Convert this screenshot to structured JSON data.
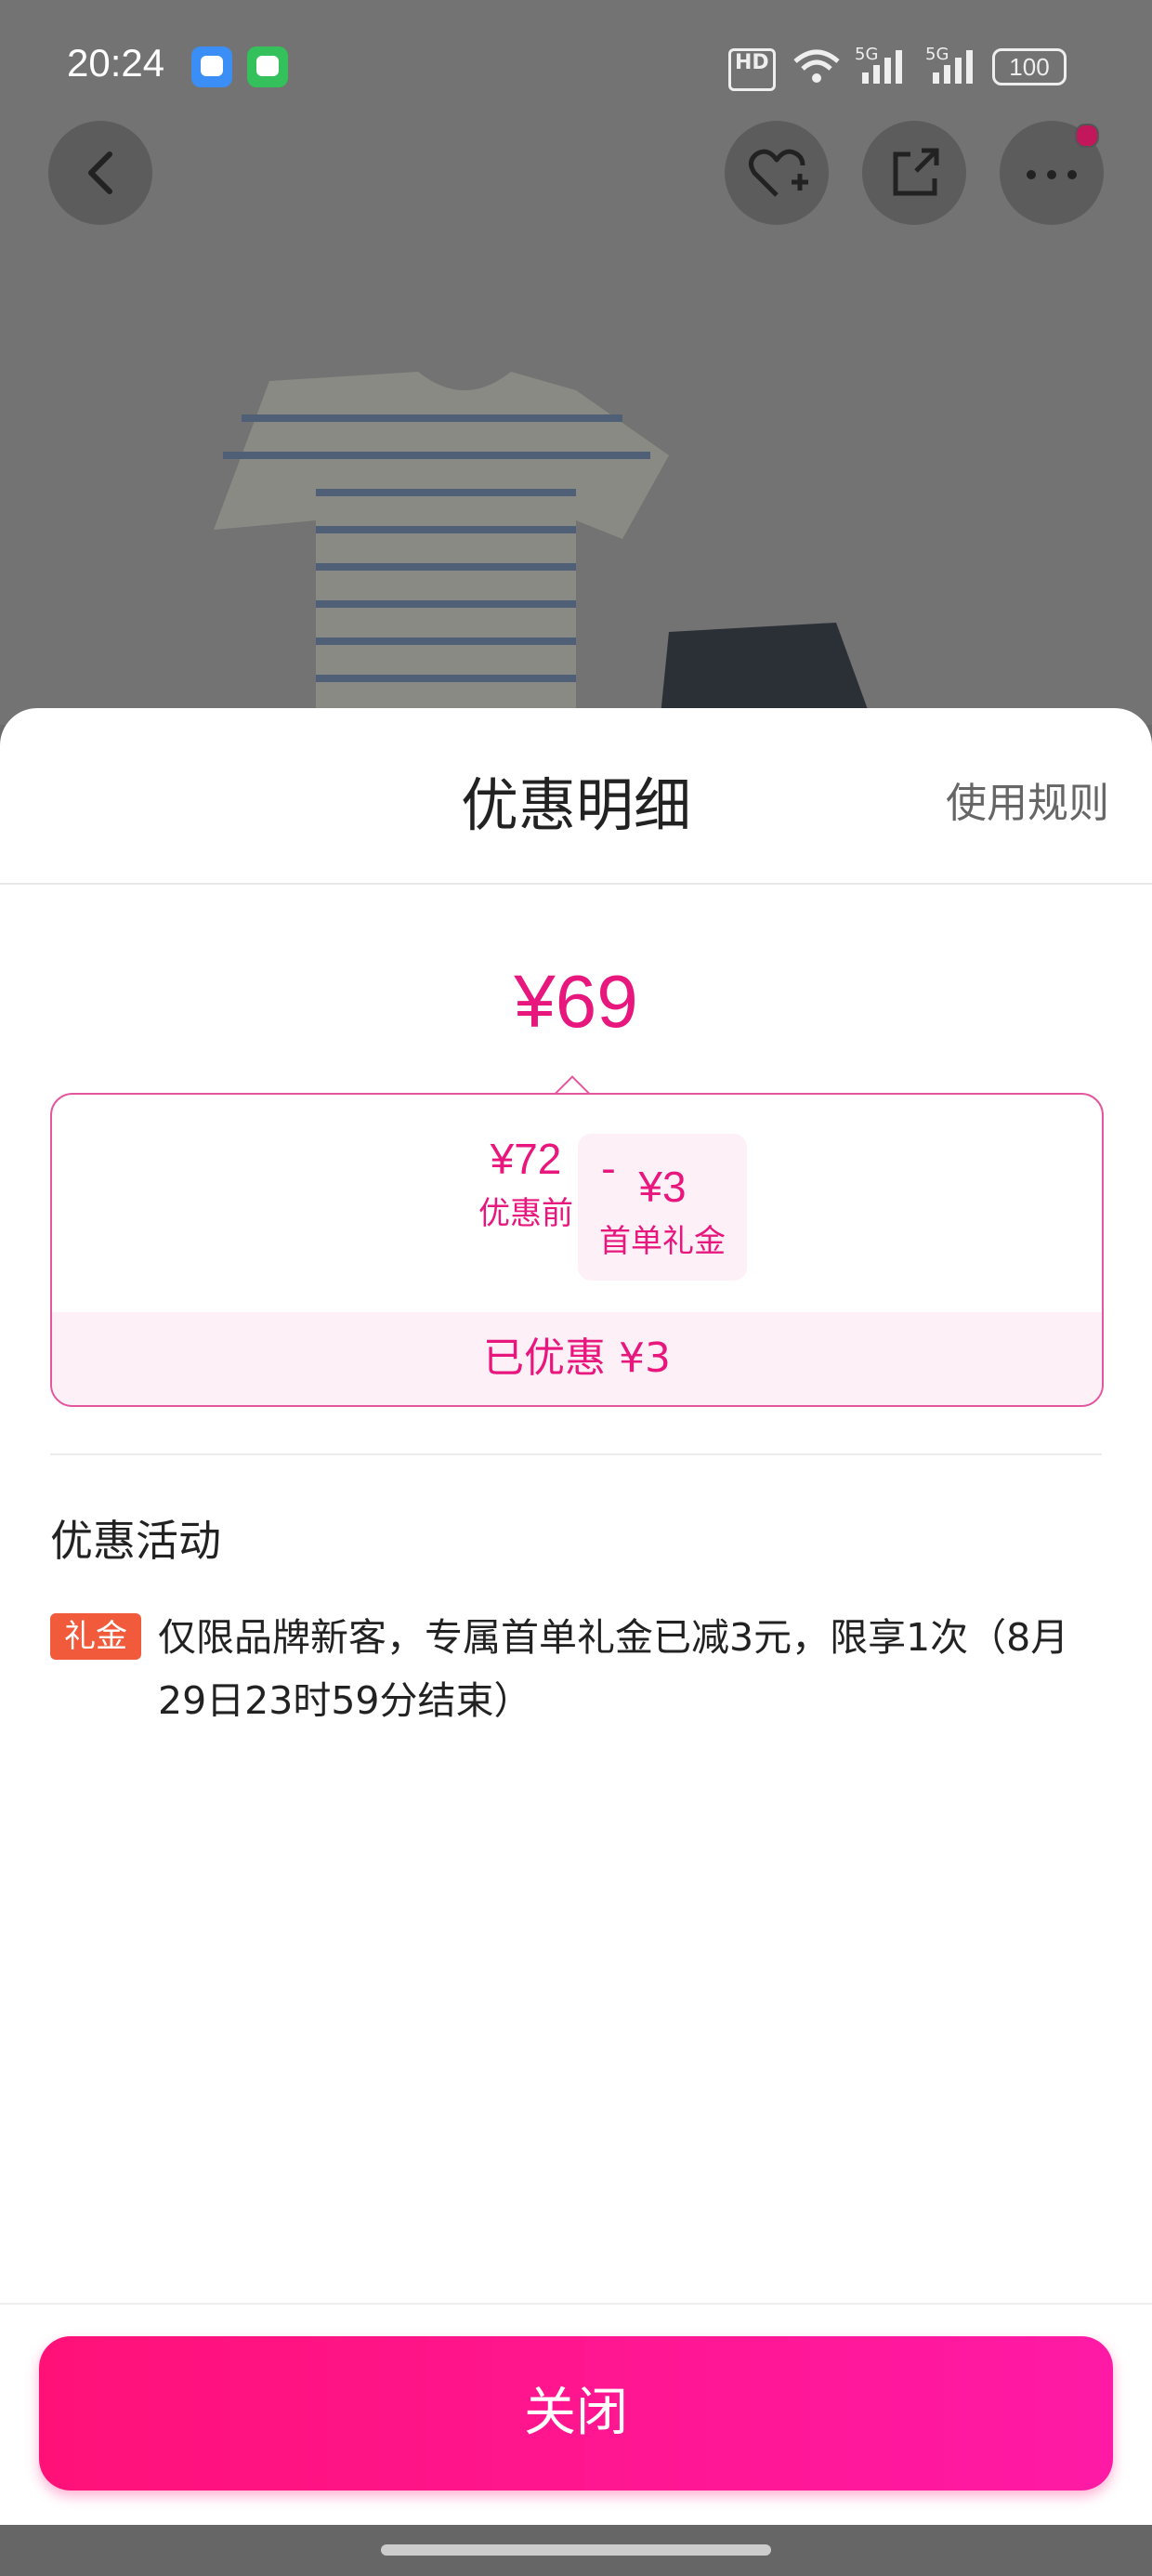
{
  "status_bar": {
    "time": "20:24",
    "hd_label": "HD",
    "net1": "5G",
    "net2": "5G",
    "battery": "100"
  },
  "icons": {
    "back": "chevron-left-icon",
    "favorite": "heart-plus-icon",
    "share": "share-icon",
    "more": "more-dots-icon"
  },
  "sheet": {
    "title": "优惠明细",
    "rules_link": "使用规则",
    "final_price": "¥69",
    "original_price": "¥72",
    "original_label": "优惠前",
    "minus": "-",
    "coupon_value": "¥3",
    "coupon_label": "首单礼金",
    "saved_text": "已优惠 ¥3",
    "section_title": "优惠活动",
    "promo_tag": "礼金",
    "promo_text": "仅限品牌新客，专属首单礼金已减3元，限享1次（8月29日23时59分结束）",
    "close_label": "关闭"
  },
  "colors": {
    "accent": "#e8177d",
    "button_gradient_start": "#ff1178",
    "button_gradient_end": "#ff1aa6",
    "tag_bg": "#f25a3c"
  }
}
